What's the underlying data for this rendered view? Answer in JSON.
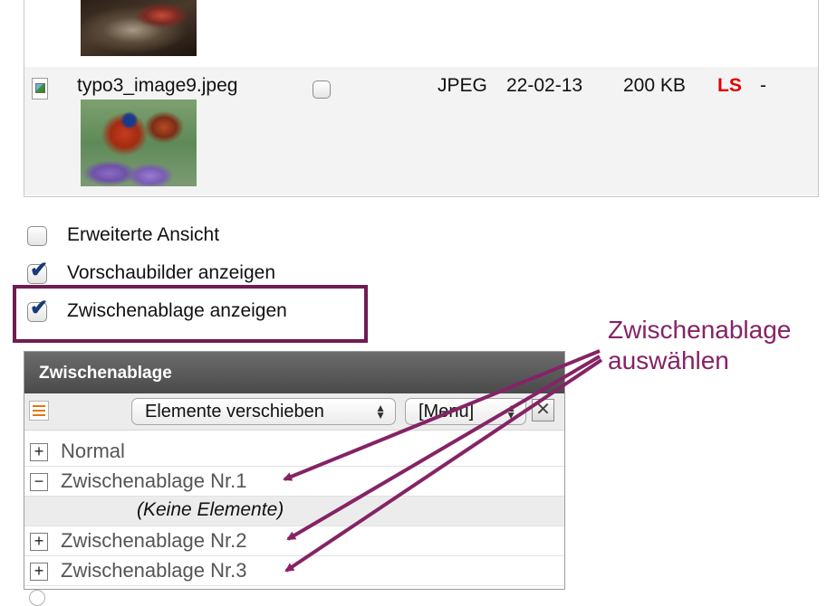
{
  "file_list": {
    "row": {
      "filename": "typo3_image9.jpeg",
      "type": "JPEG",
      "date": "22-02-13",
      "size": "200 KB",
      "ls": "LS",
      "dash": "-"
    }
  },
  "options": {
    "extended_view": {
      "label": "Erweiterte Ansicht",
      "checked": false
    },
    "thumbnails": {
      "label": "Vorschaubilder anzeigen",
      "checked": true
    },
    "clipboard": {
      "label": "Zwischenablage anzeigen",
      "checked": true
    }
  },
  "annotation": {
    "line1": "Zwischenablage",
    "line2": "auswählen",
    "color": "#852365"
  },
  "clipboard": {
    "title": "Zwischenablage",
    "action_select": "Elemente verschieben",
    "menu_select": "[Menu]",
    "close": "✕",
    "pads": [
      {
        "label": "Normal",
        "toggle": "+"
      },
      {
        "label": "Zwischenablage Nr.1",
        "toggle": "−",
        "expanded": true
      },
      {
        "label": "Zwischenablage Nr.2",
        "toggle": "+"
      },
      {
        "label": "Zwischenablage Nr.3",
        "toggle": "+"
      }
    ],
    "empty_text": "(Keine Elemente)"
  },
  "colors": {
    "highlight_border": "#6f1c52",
    "ls_red": "#e00000",
    "header_bg": "#555555"
  },
  "icons": {
    "file": "image-file-icon",
    "list": "list-view-icon",
    "close": "close-icon"
  }
}
